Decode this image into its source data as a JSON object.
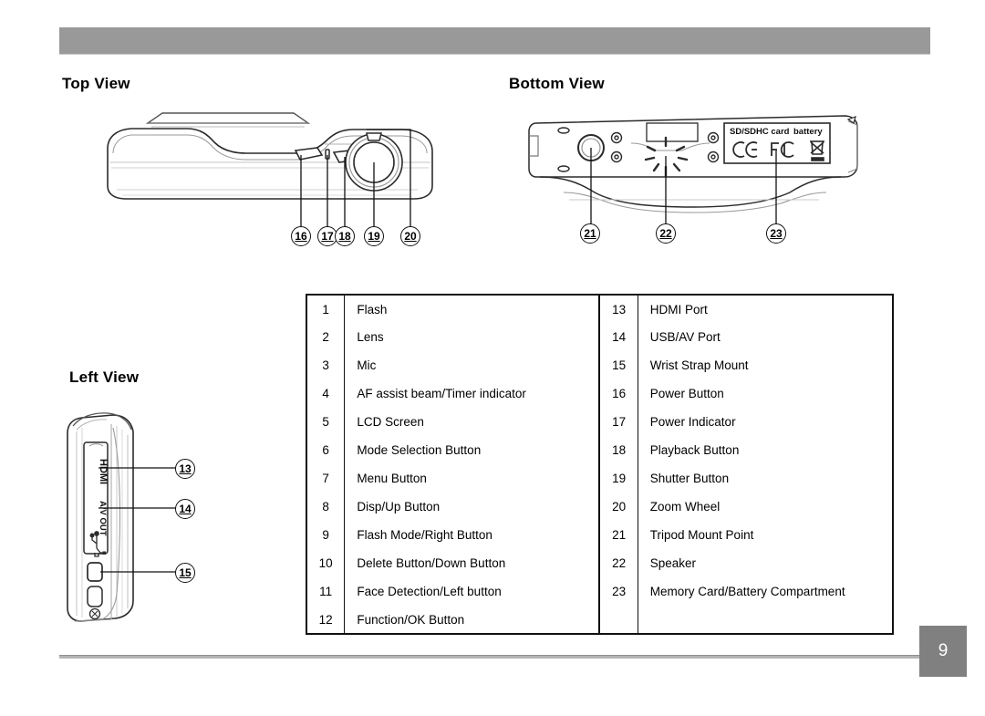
{
  "document": {
    "page_number": "9"
  },
  "sections": {
    "top_view": "Top View",
    "bottom_view": "Bottom View",
    "left_view": "Left View"
  },
  "figures": {
    "top_view": {
      "callouts": [
        "16",
        "17",
        "18",
        "19",
        "20"
      ]
    },
    "bottom_view": {
      "callouts": [
        "21",
        "22",
        "23"
      ],
      "label_sd": "SD/SDHC card",
      "label_battery": "battery",
      "marks": [
        "CE",
        "FC",
        "WEEE"
      ]
    },
    "left_view": {
      "callouts": [
        "13",
        "14",
        "15"
      ],
      "port_hdmi": "HDMI",
      "port_av": "A/V OUT",
      "port_usb": "usb-icon"
    }
  },
  "legend": {
    "rows": [
      {
        "num_left": "1",
        "label_left": "Flash",
        "num_right": "13",
        "label_right": "HDMI Port"
      },
      {
        "num_left": "2",
        "label_left": "Lens",
        "num_right": "14",
        "label_right": "USB/AV Port"
      },
      {
        "num_left": "3",
        "label_left": "Mic",
        "num_right": "15",
        "label_right": "Wrist Strap Mount"
      },
      {
        "num_left": "4",
        "label_left": "AF assist beam/Timer indicator",
        "num_right": "16",
        "label_right": "Power Button"
      },
      {
        "num_left": "5",
        "label_left": "LCD Screen",
        "num_right": "17",
        "label_right": "Power Indicator"
      },
      {
        "num_left": "6",
        "label_left": "Mode Selection Button",
        "num_right": "18",
        "label_right": "Playback Button"
      },
      {
        "num_left": "7",
        "label_left": "Menu Button",
        "num_right": "19",
        "label_right": "Shutter Button"
      },
      {
        "num_left": "8",
        "label_left": "Disp/Up Button",
        "num_right": "20",
        "label_right": "Zoom Wheel"
      },
      {
        "num_left": "9",
        "label_left": "Flash Mode/Right Button",
        "num_right": "21",
        "label_right": "Tripod Mount Point"
      },
      {
        "num_left": "10",
        "label_left": "Delete Button/Down Button",
        "num_right": "22",
        "label_right": "Speaker"
      },
      {
        "num_left": "11",
        "label_left": "Face Detection/Left button",
        "num_right": "23",
        "label_right": "Memory Card/Battery Compartment"
      },
      {
        "num_left": "12",
        "label_left": "Function/OK Button",
        "num_right": "",
        "label_right": ""
      }
    ]
  },
  "colors": {
    "header_band": "#999999",
    "page_badge": "#808080",
    "footer_rule": "#b3b3b3",
    "line": "#111111"
  }
}
